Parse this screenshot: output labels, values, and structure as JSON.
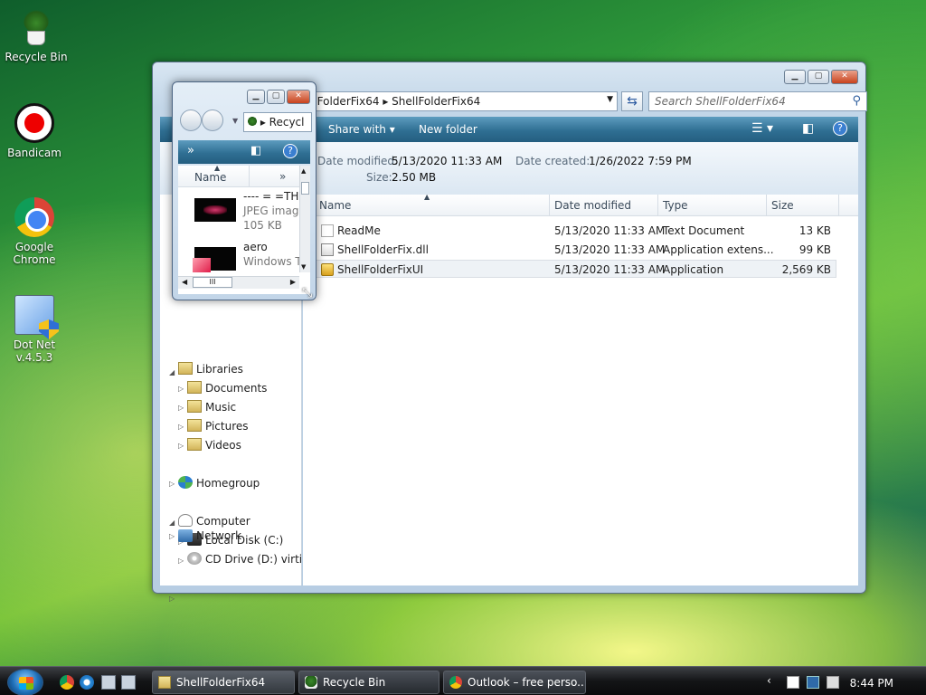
{
  "desktop": {
    "icons": [
      {
        "label": "Recycle Bin"
      },
      {
        "label": "Bandicam"
      },
      {
        "label": "Google Chrome"
      },
      {
        "label": "Dot Net v.4.5.3"
      }
    ]
  },
  "explorer": {
    "address": [
      "llFolderFix64",
      "ShellFolderFix64"
    ],
    "search_placeholder": "Search ShellFolderFix64",
    "commands": {
      "share": "Share with",
      "newfolder": "New folder"
    },
    "details": {
      "modified_label": "Date modified:",
      "modified_value": "5/13/2020 11:33 AM",
      "created_label": "Date created:",
      "created_value": "1/26/2022 7:59 PM",
      "size_label": "Size:",
      "size_value": "2.50 MB"
    },
    "columns": [
      "Name",
      "Date modified",
      "Type",
      "Size"
    ],
    "files": [
      {
        "name": "ReadMe",
        "date": "5/13/2020 11:33 AM",
        "type": "Text Document",
        "size": "13 KB"
      },
      {
        "name": "ShellFolderFix.dll",
        "date": "5/13/2020 11:33 AM",
        "type": "Application extens...",
        "size": "99 KB"
      },
      {
        "name": "ShellFolderFixUI",
        "date": "5/13/2020 11:33 AM",
        "type": "Application",
        "size": "2,569 KB"
      }
    ],
    "nav": {
      "libraries": "Libraries",
      "documents": "Documents",
      "music": "Music",
      "pictures": "Pictures",
      "videos": "Videos",
      "homegroup": "Homegroup",
      "computer": "Computer",
      "localdisk": "Local Disk (C:)",
      "cddrive": "CD Drive (D:) virtio-w",
      "network": "Network"
    }
  },
  "popup": {
    "address": "Recycl",
    "column_name": "Name",
    "more": "»",
    "items": [
      {
        "title": "---- = =TH",
        "type": "JPEG image",
        "size": "105 KB"
      },
      {
        "title": "aero",
        "type": "Windows T"
      }
    ],
    "hscroll_grip": "III"
  },
  "taskbar": {
    "buttons": [
      {
        "label": "ShellFolderFix64"
      },
      {
        "label": "Recycle Bin"
      },
      {
        "label": "Outlook – free perso..."
      }
    ],
    "clock": "8:44 PM"
  }
}
